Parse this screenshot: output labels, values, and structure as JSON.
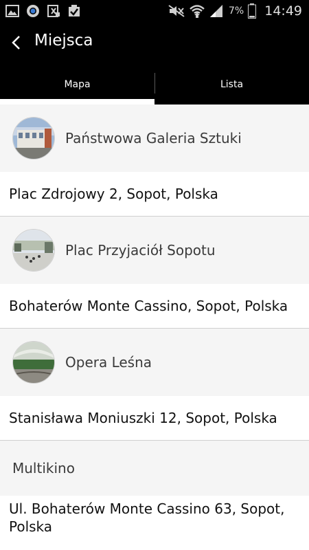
{
  "status_bar": {
    "battery_percent": "7%",
    "time": "14:49",
    "icons": [
      "gallery-icon",
      "chrome-icon",
      "excel-icon",
      "checklist-icon",
      "mute-icon",
      "wifi-icon",
      "signal-icon",
      "battery-icon"
    ]
  },
  "app_bar": {
    "title": "Miejsca"
  },
  "tabs": [
    {
      "label": "Mapa",
      "selected": true
    },
    {
      "label": "Lista",
      "selected": false
    }
  ],
  "places": [
    {
      "name": "Państwowa Galeria Sztuki",
      "address": "Plac Zdrojowy 2, Sopot, Polska",
      "has_image": true
    },
    {
      "name": "Plac Przyjaciół Sopotu",
      "address": "Bohaterów Monte Cassino, Sopot, Polska",
      "has_image": true
    },
    {
      "name": "Opera Leśna",
      "address": "Stanisława Moniuszki 12, Sopot, Polska",
      "has_image": true
    },
    {
      "name": "Multikino",
      "address": "Ul. Bohaterów Monte Cassino 63, Sopot, Polska",
      "has_image": false
    }
  ],
  "colors": {
    "header_bg": "#000000",
    "row_header_bg": "#f5f5f5",
    "address_bg": "#ffffff",
    "tab_indicator": "#ffffff"
  }
}
